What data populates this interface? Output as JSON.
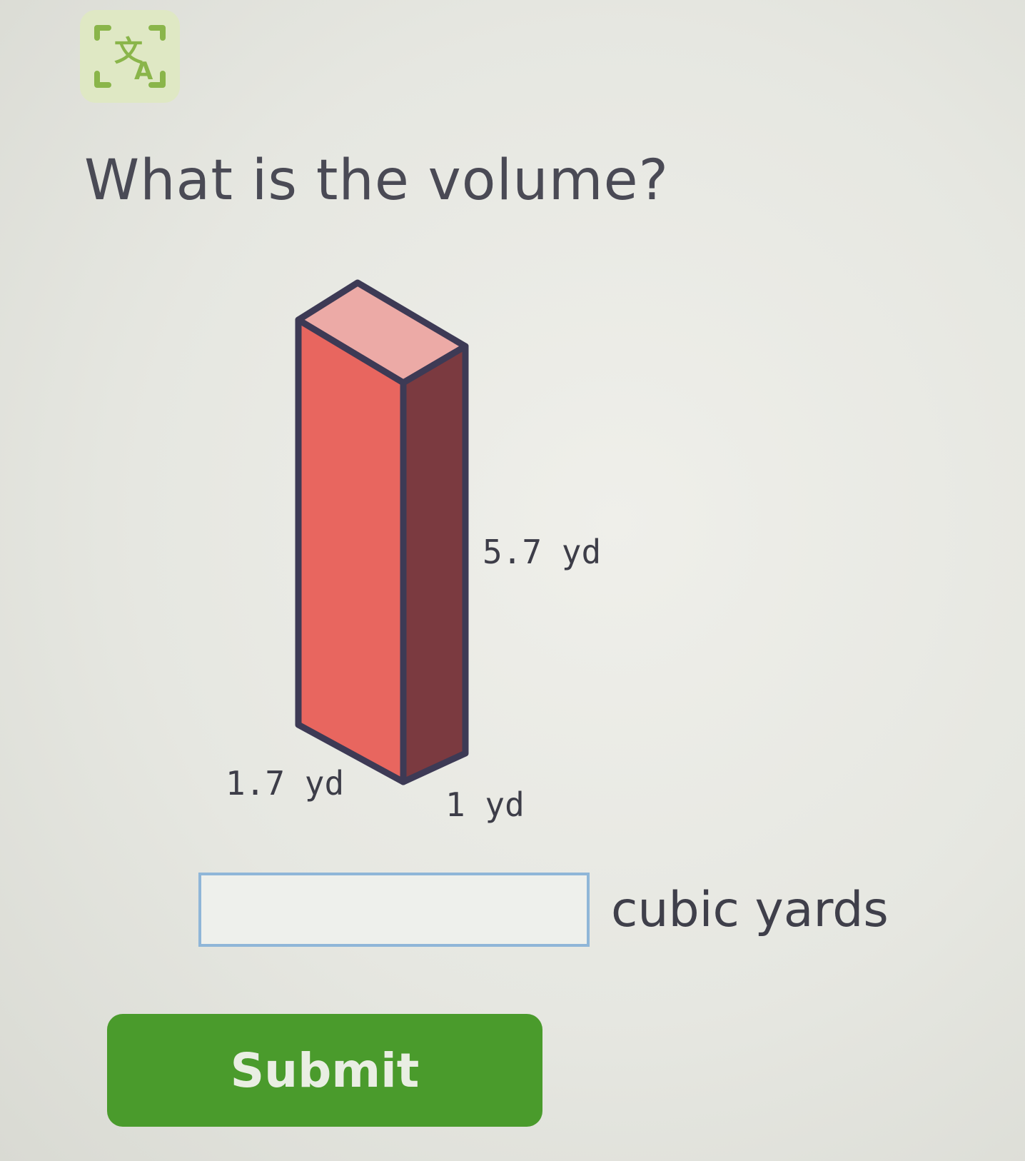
{
  "toolbar": {
    "translate_icon": "translate-icon",
    "accent": "#7fb03a"
  },
  "question": {
    "text": "What is the volume?"
  },
  "figure": {
    "shape": "rectangular prism",
    "height_label": "5.7 yd",
    "length_label": "1.7 yd",
    "width_label": "1 yd",
    "colors": {
      "front": "#e8665f",
      "side": "#7b3a40",
      "top": "#ecaaa6",
      "edge": "#3d3a55"
    }
  },
  "answer": {
    "value": "",
    "placeholder": "",
    "unit": "cubic yards"
  },
  "submit": {
    "label": "Submit",
    "color": "#4a9b2c"
  }
}
